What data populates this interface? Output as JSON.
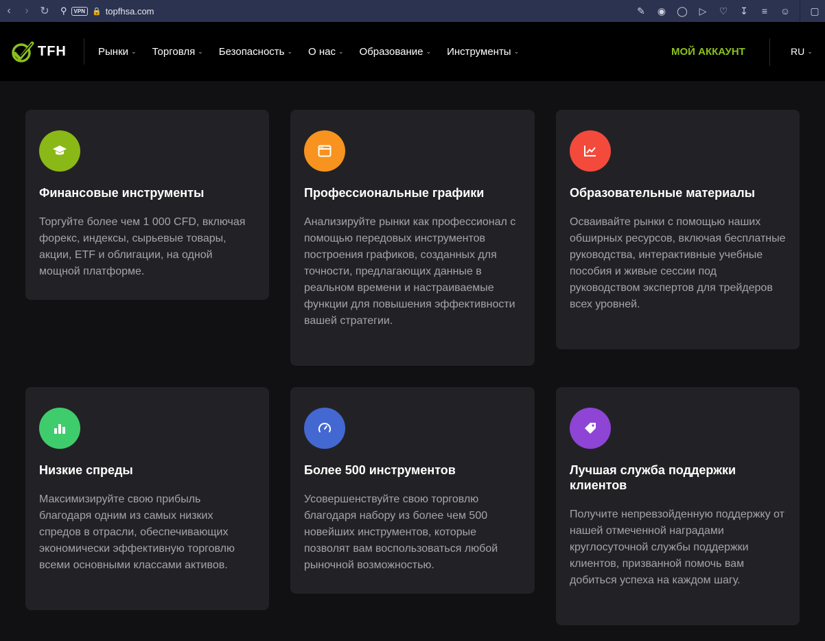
{
  "browser": {
    "url": "topfhsa.com",
    "vpn_label": "VPN"
  },
  "header": {
    "logo_text": "TFH",
    "nav": [
      {
        "label": "Рынки"
      },
      {
        "label": "Торговля"
      },
      {
        "label": "Безопасность"
      },
      {
        "label": "О нас"
      },
      {
        "label": "Образование"
      },
      {
        "label": "Инструменты"
      }
    ],
    "account_label": "МОЙ АККАУНТ",
    "lang_label": "RU"
  },
  "colors": {
    "accent": "#8bc01c",
    "icon_green": "#8ab817",
    "icon_orange": "#f7931e",
    "icon_red": "#f34a3c",
    "icon_mint": "#3fcc6c",
    "icon_blue": "#4468d2",
    "icon_purple": "#8e44d4"
  },
  "cards": [
    {
      "icon": "graduation-cap-icon",
      "title": "Финансовые инструменты",
      "text": "Торгуйте более чем 1 000 CFD, включая форекс, индексы, сырьевые товары, акции, ETF и облигации, на одной мощной платформе."
    },
    {
      "icon": "browser-window-icon",
      "title": "Профессиональные графики",
      "text": "Анализируйте рынки как профессионал с помощью передовых инструментов построения графиков, созданных для точности, предлагающих данные в реальном времени и настраиваемые функции для повышения эффективности вашей стратегии."
    },
    {
      "icon": "line-chart-icon",
      "title": "Образовательные материалы",
      "text": "Осваивайте рынки с помощью наших обширных ресурсов, включая бесплатные руководства, интерактивные учебные пособия и живые сессии под руководством экспертов для трейдеров всех уровней."
    },
    {
      "icon": "bar-chart-icon",
      "title": "Низкие спреды",
      "text": "Максимизируйте свою прибыль благодаря одним из самых низких спредов в отрасли, обеспечивающих экономически эффективную торговлю всеми основными классами активов."
    },
    {
      "icon": "speedometer-icon",
      "title": "Более 500 инструментов",
      "text": "Усовершенствуйте свою торговлю благодаря набору из более чем 500 новейших инструментов, которые позволят вам воспользоваться любой рыночной возможностью."
    },
    {
      "icon": "tag-icon",
      "title": "Лучшая служба поддержки клиентов",
      "text": "Получите непревзойденную поддержку от нашей отмеченной наградами круглосуточной службы поддержки клиентов, призванной помочь вам добиться успеха на каждом шагу."
    }
  ]
}
